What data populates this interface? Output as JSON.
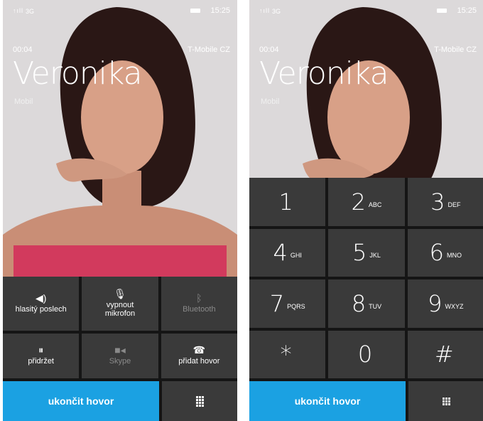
{
  "status": {
    "signal": "↑ıll",
    "network": "3G",
    "time": "15:25"
  },
  "call": {
    "duration": "00:04",
    "carrier": "T-Mobile CZ",
    "name": "Veronika",
    "number_type": "Mobil"
  },
  "controls": [
    {
      "label": "hlasitý poslech",
      "icon": "speaker-icon",
      "glyph": "◀)"
    },
    {
      "label": "vypnout mikrofon",
      "icon": "mic-off-icon",
      "glyph": "🎙"
    },
    {
      "label": "Bluetooth",
      "icon": "bluetooth-icon",
      "glyph": "ᛒ"
    },
    {
      "label": "přidržet",
      "icon": "pause-icon",
      "glyph": "⏸"
    },
    {
      "label": "Skype",
      "icon": "skype-video-icon",
      "glyph": "■◂"
    },
    {
      "label": "přidat hovor",
      "icon": "add-call-icon",
      "glyph": "☎"
    }
  ],
  "keypad": [
    {
      "digit": "1",
      "letters": ""
    },
    {
      "digit": "2",
      "letters": "ABC"
    },
    {
      "digit": "3",
      "letters": "DEF"
    },
    {
      "digit": "4",
      "letters": "GHI"
    },
    {
      "digit": "5",
      "letters": "JKL"
    },
    {
      "digit": "6",
      "letters": "MNO"
    },
    {
      "digit": "7",
      "letters": "PQRS"
    },
    {
      "digit": "8",
      "letters": "TUV"
    },
    {
      "digit": "9",
      "letters": "WXYZ"
    },
    {
      "digit": "*",
      "letters": ""
    },
    {
      "digit": "0",
      "letters": ""
    },
    {
      "digit": "#",
      "letters": ""
    }
  ],
  "end_call_label": "ukončit hovor",
  "colors": {
    "accent": "#1ba1e2",
    "tile": "#3a3a3a",
    "background": "#151515",
    "disabled_text": "#8a8a8a"
  }
}
